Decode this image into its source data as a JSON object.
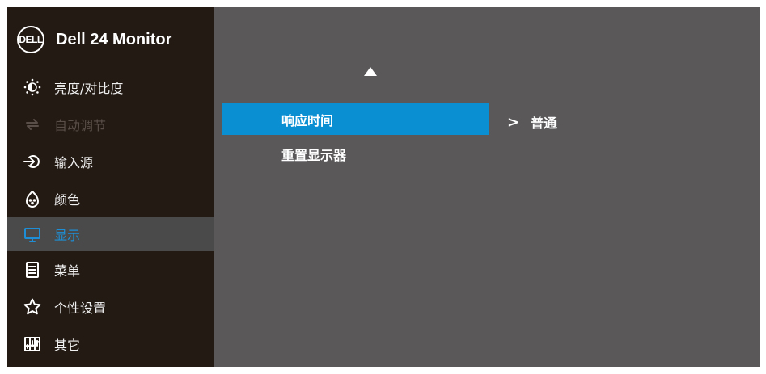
{
  "header": {
    "logo_text": "DELL",
    "title": "Dell 24 Monitor"
  },
  "sidebar": {
    "items": [
      {
        "label": "亮度/对比度",
        "icon": "brightness-icon"
      },
      {
        "label": "自动调节",
        "icon": "auto-adjust-icon",
        "state": "disabled"
      },
      {
        "label": "输入源",
        "icon": "input-source-icon"
      },
      {
        "label": "颜色",
        "icon": "color-icon"
      },
      {
        "label": "显示",
        "icon": "display-icon",
        "state": "selected"
      },
      {
        "label": "菜单",
        "icon": "menu-icon"
      },
      {
        "label": "个性设置",
        "icon": "star-icon"
      },
      {
        "label": "其它",
        "icon": "others-icon"
      }
    ]
  },
  "main": {
    "scroll_indicator": "up-arrow",
    "submenu": [
      {
        "label": "响应时间",
        "selected": true
      },
      {
        "label": "重置显示器",
        "selected": false
      }
    ],
    "value": {
      "chevron": ">",
      "text": "普通"
    }
  },
  "colors": {
    "sidebar_bg": "#231a14",
    "main_bg": "#5a5859",
    "accent": "#0a8fd3",
    "active_text": "#1e8fd6",
    "disabled_text": "#5a4f48"
  }
}
